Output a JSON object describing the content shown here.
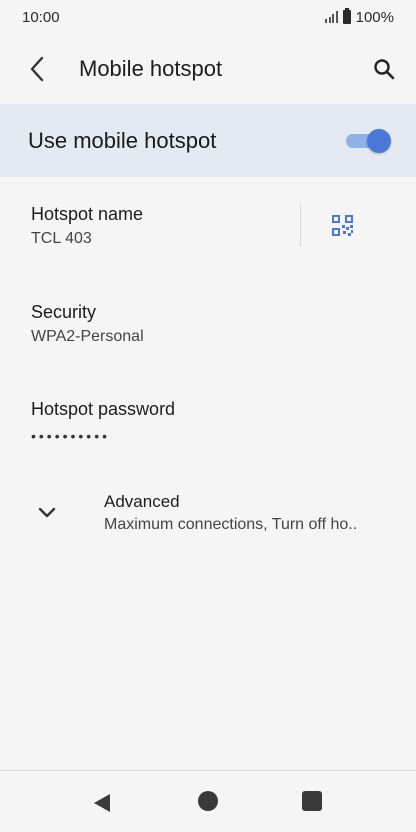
{
  "status_bar": {
    "time": "10:00",
    "battery": "100%"
  },
  "app_bar": {
    "title": "Mobile hotspot",
    "back_icon": "arrow-back-icon",
    "search_icon": "search-icon"
  },
  "master_switch": {
    "label": "Use mobile hotspot",
    "checked": true
  },
  "preferences": {
    "hotspot_name": {
      "title": "Hotspot name",
      "summary": "TCL 403",
      "action_icon": "qr-code-icon"
    },
    "security": {
      "title": "Security",
      "summary": "WPA2-Personal"
    },
    "password": {
      "title": "Hotspot password",
      "masked_value": "••••••••••"
    },
    "advanced": {
      "title": "Advanced",
      "summary": "Maximum connections, Turn off ho..",
      "icon": "chevron-down-icon"
    }
  },
  "colors": {
    "accent": "#4a78d6",
    "track": "#8fb1e6",
    "highlight_row": "#e4e9f2",
    "background": "#f5f5f5"
  }
}
